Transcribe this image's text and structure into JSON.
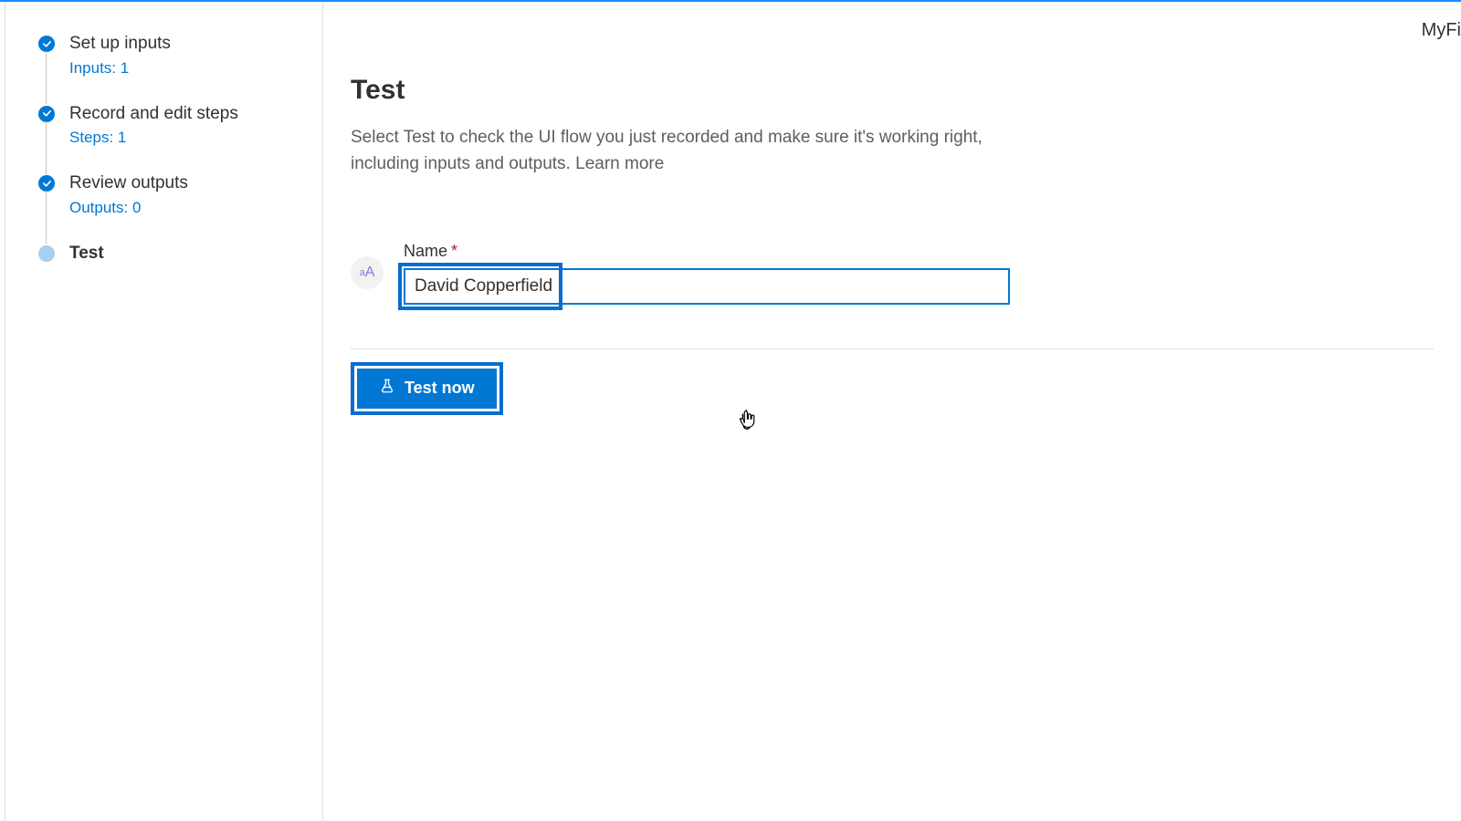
{
  "topRight": "MyFi",
  "sidebar": {
    "steps": [
      {
        "title": "Set up inputs",
        "sub": "Inputs: 1",
        "state": "done"
      },
      {
        "title": "Record and edit steps",
        "sub": "Steps: 1",
        "state": "done"
      },
      {
        "title": "Review outputs",
        "sub": "Outputs: 0",
        "state": "done"
      },
      {
        "title": "Test",
        "sub": "",
        "state": "current"
      }
    ]
  },
  "main": {
    "title": "Test",
    "description": "Select Test to check the UI flow you just recorded and make sure it's working right, including inputs and outputs. ",
    "learnMore": "Learn more",
    "field": {
      "label": "Name",
      "required": "*",
      "value": "David Copperfield",
      "typeBadge": "aA"
    },
    "button": {
      "label": "Test now"
    }
  }
}
